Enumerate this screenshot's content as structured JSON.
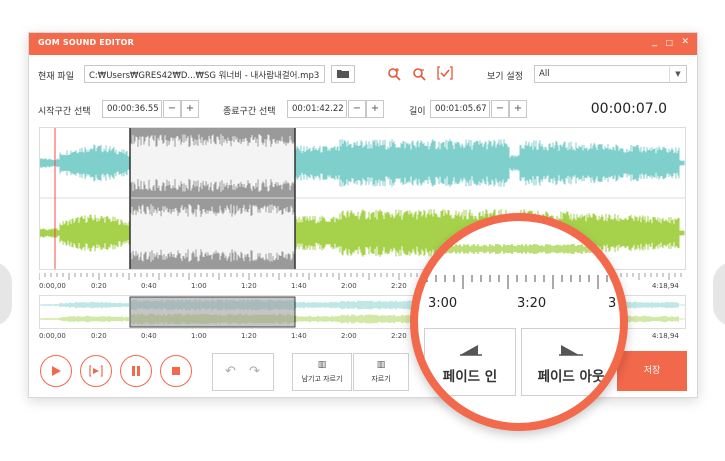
{
  "window": {
    "title": "GOM SOUND EDITOR",
    "minimize": "_",
    "maximize": "□",
    "close": "✕"
  },
  "file": {
    "label": "현재 파일",
    "path": "C:₩Users₩GRES42₩D...₩SG 워너비 - 내사람내걸어.mp3",
    "view_label": "보기 설정",
    "view_value": "All"
  },
  "selection": {
    "start_label": "시작구간 선택",
    "start_value": "00:00:36.55",
    "end_label": "종료구간 선택",
    "end_value": "00:01:42.22",
    "length_label": "길이",
    "length_value": "00:01:05.67",
    "current_time": "00:00:07.0"
  },
  "ruler": [
    "0:00,00",
    "0:20",
    "0:40",
    "1:00",
    "1:20",
    "1:40",
    "2:00",
    "2:20",
    "4:18,94"
  ],
  "mini_ruler": [
    "0:00,00",
    "0:20",
    "0:40",
    "1:00",
    "1:20",
    "1:40",
    "2:00",
    "2:20",
    "4:18,94"
  ],
  "buttons": {
    "keep_cut": "남기고 자르기",
    "cut": "자르기",
    "save": "저장"
  },
  "magnifier": {
    "time1": "3:00",
    "time2": "3:20",
    "time3": "3",
    "fade_in": "페이드 인",
    "fade_out": "페이드 아웃"
  },
  "colors": {
    "accent": "#f26a4b",
    "waveform_top": "#7fcfcc",
    "waveform_bottom": "#a6d24b",
    "selection": "#999999"
  }
}
